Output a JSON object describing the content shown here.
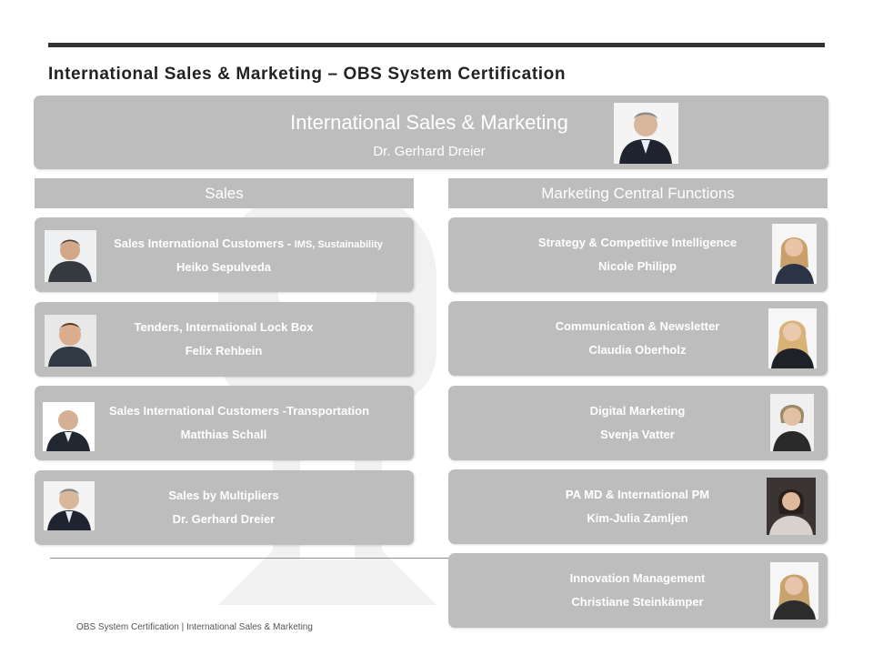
{
  "page": {
    "title": "International Sales & Marketing – OBS System Certification",
    "footer": "OBS System Certification | International Sales & Marketing"
  },
  "head": {
    "title": "International Sales & Marketing",
    "name": "Dr. Gerhard Dreier",
    "photo_icon": "man-portrait-icon"
  },
  "sales": {
    "header": "Sales",
    "cards": [
      {
        "title": "Sales International Customers  - ",
        "title_suffix": "IMS, Sustainability",
        "name": "Heiko Sepulveda"
      },
      {
        "title": "Tenders, International Lock Box",
        "name": "Felix Rehbein"
      },
      {
        "title": "Sales International Customers -Transportation",
        "name": "Matthias Schall"
      },
      {
        "title": "Sales by Multipliers",
        "name": "Dr. Gerhard Dreier"
      }
    ]
  },
  "marketing": {
    "header": "Marketing Central Functions",
    "cards": [
      {
        "title": "Strategy & Competitive Intelligence",
        "name": "Nicole Philipp"
      },
      {
        "title": "Communication & Newsletter",
        "name": "Claudia Oberholz"
      },
      {
        "title": "Digital Marketing",
        "name": "Svenja Vatter"
      },
      {
        "title": "PA MD & International PM",
        "name": "Kim-Julia Zamljen"
      },
      {
        "title": "Innovation Management",
        "name": "Christiane Steinkämper"
      }
    ]
  },
  "colors": {
    "box": "#bdbdbd",
    "text_on_box": "#ffffff",
    "rule": "#333333"
  }
}
